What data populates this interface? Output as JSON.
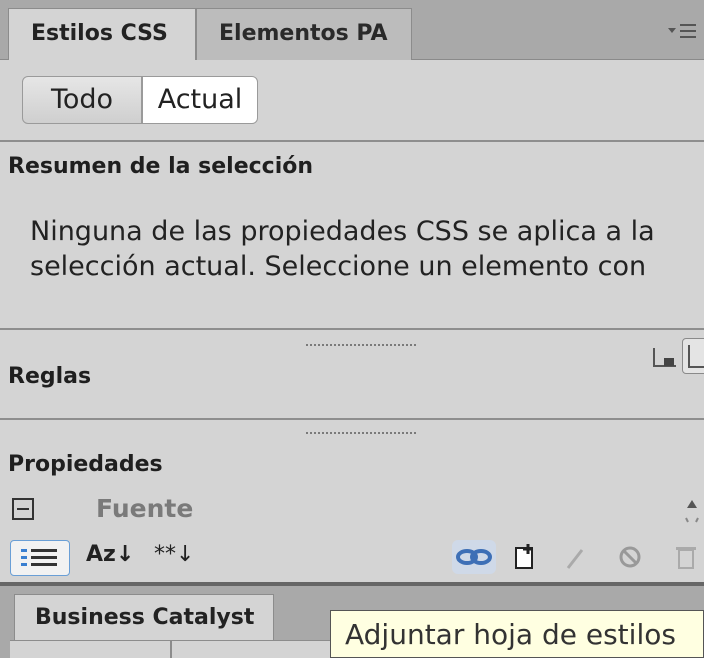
{
  "tabs": {
    "estilos_css": "Estilos CSS",
    "elementos_pa": "Elementos PA",
    "menu_icon": "panel-menu-icon"
  },
  "mode": {
    "todo": "Todo",
    "actual": "Actual",
    "selected": "Actual"
  },
  "summary": {
    "title": "Resumen de la selección",
    "text": "Ninguna de las propiedades CSS se aplica a la selección actual.  Seleccione un elemento con"
  },
  "rules": {
    "title": "Reglas"
  },
  "properties": {
    "title": "Propiedades",
    "group": "Fuente"
  },
  "toolbar": {
    "az_label": "Az",
    "star_label": "**"
  },
  "bottom": {
    "tab": "Business Catalyst"
  },
  "tooltip": "Adjuntar hoja de estilos",
  "colors": {
    "panel_bg": "#d4d4d4",
    "tab_bar": "#a9a9a9",
    "tooltip_bg": "#ffffe1"
  }
}
